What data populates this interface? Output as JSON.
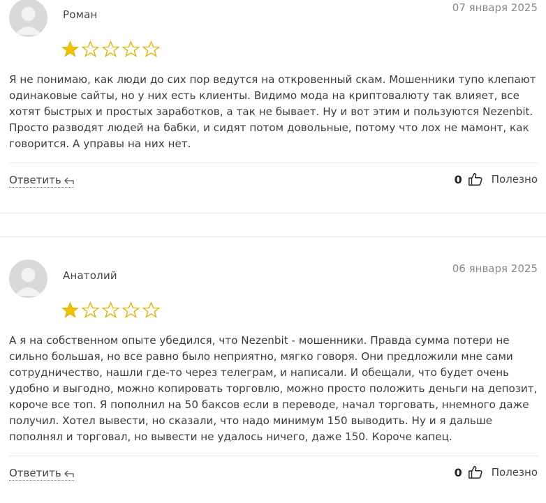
{
  "reviews": [
    {
      "author": "Роман",
      "date": "07 января 2025",
      "rating": 1,
      "max_rating": 5,
      "lines": [
        "Я не понимаю, как люди до сих пор ведутся на откровенный скам. Мошенники тупо клепают",
        "одинаковые сайты, но у них есть клиенты. Видимо мода на криптовалюту так влияет, все",
        "хотят быстрых и простых заработков, а так не бывает. Ну и вот этим и пользуются Nezenbit.",
        "Просто разводят людей на бабки, и сидят потом довольные, потому что лох не мамонт, как",
        "говорится. А управы на них нет."
      ],
      "reply_label": "Ответить",
      "likes": "0",
      "useful_label": "Полезно"
    },
    {
      "author": "Анатолий",
      "date": "06 января 2025",
      "rating": 1,
      "max_rating": 5,
      "lines": [
        "А я на собственном опыте убедился, что Nezenbit - мошенники. Правда сумма потери не",
        "сильно большая, но все равно было неприятно, мягко говоря. Они предложили мне сами",
        "сотрудничество, нашли где-то через телеграм, и написали. И обещали, что будет очень",
        "удобно и выгодно, можно копировать торговлю, можно просто положить деньги на депозит,",
        "короче все топ. Я пополнил на 50 баксов если в переводе, начал торговать, ннемного даже",
        "получил. Хотел вывести, но сказали, что надо минимум 150 выводить. Ну и я дальше",
        "пополнял и торговал, но вывести не удалось ничего, даже 150. Короче капец."
      ],
      "reply_label": "Ответить",
      "likes": "0",
      "useful_label": "Полезно"
    }
  ],
  "colors": {
    "star_filled": "#f2c200",
    "star_stroke": "#e2b300",
    "avatar_bg": "#d9d9d9",
    "avatar_fg": "#f2f2f2"
  }
}
